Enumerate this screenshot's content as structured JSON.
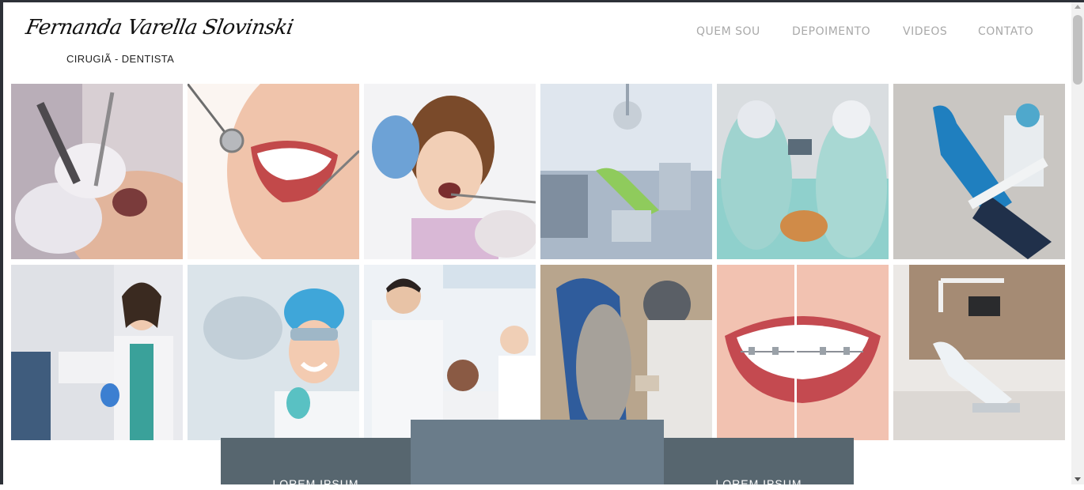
{
  "header": {
    "brand_name": "Fernanda Varella Slovinski",
    "brand_tagline": "CIRUGIÃ - DENTISTA"
  },
  "nav": {
    "items": [
      "QUEM SOU",
      "DEPOIMENTO",
      "VIDEOS",
      "CONTATO"
    ]
  },
  "gallery": {
    "rows": [
      [
        "dental-procedure-photo",
        "smile-mirror-photo",
        "child-patient-photo",
        "dental-clinic-room-photo",
        "surgeons-operating-photo",
        "blue-dental-chair-photo"
      ],
      [
        "dentist-woman-photo",
        "dentist-mask-cap-photo",
        "dentist-elderly-patient-photo",
        "dental-treatment-photo",
        "braces-smile-photo",
        "white-dental-chair-photo"
      ]
    ]
  },
  "bottom": {
    "left_label": "LOREM IPSUM",
    "right_label": "LOREM IPSUM"
  },
  "colors": {
    "frame": "#2d3138",
    "nav_text": "#a9a9a9",
    "band_dark": "#57666f",
    "band_mid": "#6a7c8a"
  }
}
